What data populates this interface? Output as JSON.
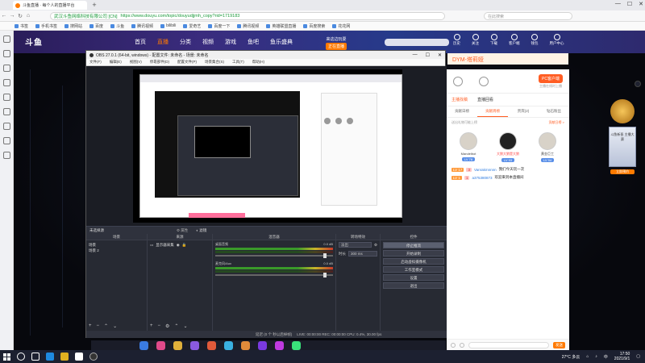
{
  "browser": {
    "tab_title": "斗鱼直播 · 每个人的直播平台",
    "url_cert": "武汉斗鱼网络科技有限公司 [CN]",
    "url": "https://www.douyu.com/topic/douyudjjmh_copy?rid=1719183",
    "search_placeholder": "在此搜索",
    "bookmarks": [
      "书签",
      "手机书签",
      "搜网站",
      "百度",
      "斗鱼",
      "腾讯视频",
      "bilibili",
      "爱奇艺",
      "百度一下",
      "腾讯视频",
      "英雄联盟直播",
      "百度搜索",
      "花花网"
    ]
  },
  "site": {
    "logo": "斗鱼",
    "nav": [
      "首页",
      "直播",
      "分类",
      "视频",
      "游戏",
      "鱼吧",
      "鱼乐盛典"
    ],
    "nav_active": "直播",
    "live_label": "来这边玩耍",
    "live_button": "正在直播",
    "header_icons": [
      "历史",
      "关注",
      "下载",
      "客户端",
      "钱包",
      "用户中心"
    ]
  },
  "room": {
    "title": "DYM-塔莉娅",
    "pc_button": "PC客户端",
    "pc_sub": "主播在线时上播",
    "tabs": [
      "主播找稿",
      "直播回看"
    ],
    "sub_tabs": [
      "贡献日榜",
      "贡献周榜",
      "贵宾(2)",
      "钻石粉丝"
    ],
    "note": "送出礼物可能上榜",
    "note_link": "贡献日榜 >",
    "podium": [
      {
        "name": "Mandelbot",
        "level": "LV 78"
      },
      {
        "name": "大狼大狼是大狼",
        "level": "LV 93"
      },
      {
        "name": "黄金巨工",
        "level": "LV 94"
      }
    ],
    "chat": [
      {
        "tag": "LV 17",
        "tag2": "3",
        "nick": "Vanrakmnnnn",
        "text": "我们今天玩一次"
      },
      {
        "tag": "LV 1",
        "tag2": "1",
        "nick": "a375380873",
        "text": "欢迎来到本直播间"
      }
    ],
    "send_label": "发送"
  },
  "side_ad": {
    "title": "斗鱼盛典",
    "card_text": "斗鱼新晋 主播大赛",
    "button": "立即预约"
  },
  "notice": "主播已经上线啦,可发送图片 给主播即可获得福利奖励哦",
  "obs": {
    "title": "OBS 27.0.1 (64-bit, windows) - 配置文件: 未命名 - 场景: 未命名",
    "menu": [
      "文件(F)",
      "编辑(E)",
      "视图(V)",
      "停靠部件(D)",
      "配置文件(P)",
      "场景集合(S)",
      "工具(T)",
      "帮助(H)"
    ],
    "status_top": {
      "label": "未选择源",
      "properties": "属性",
      "filters": "滤镜"
    },
    "docks": {
      "scenes": {
        "header": "场景",
        "items": [
          "场景",
          "场景 2"
        ]
      },
      "sources": {
        "header": "来源",
        "items": [
          "显示器采集"
        ]
      },
      "mixer": {
        "header": "混音器",
        "channels": [
          {
            "name": "桌面音频",
            "db": "0.0 dB"
          },
          {
            "name": "麦克风/Aux",
            "db": "0.0 dB"
          }
        ]
      },
      "transitions": {
        "header": "转场特效",
        "type": "淡出",
        "duration_label": "时长",
        "duration": "300 ms"
      },
      "controls": {
        "header": "控件",
        "buttons": [
          "停止推流",
          "开始录制",
          "启动虚拟摄像机",
          "工作室模式",
          "设置",
          "退出"
        ]
      }
    },
    "statusbar": "LIVE: 00:00:00   REC: 00:00:00   CPU: 0.4%, 30.00 fps",
    "dropped": "延迟 (0 个 秒以后掉帧)"
  },
  "taskbar": {
    "weather": "27°C 多云",
    "ime": "中",
    "time": "17:50",
    "date": "2021/9/1"
  }
}
